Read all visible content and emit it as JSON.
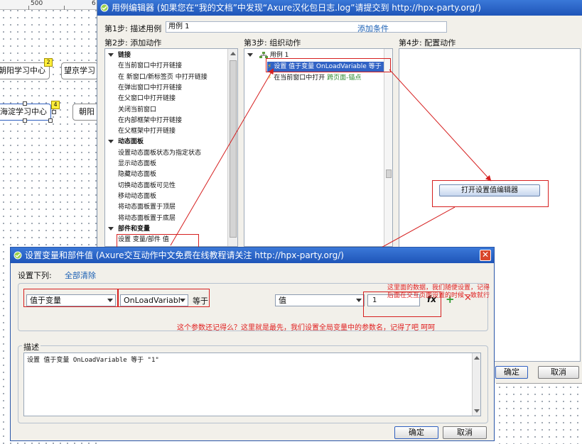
{
  "canvas": {
    "ruler_mark": "500",
    "ruler_mark_right": "6",
    "widgets": [
      {
        "label": "朝阳学习中心",
        "badge": "2"
      },
      {
        "label": "望京学习"
      },
      {
        "label": "海淀学习中心",
        "badge": "4"
      },
      {
        "label": "朝阳"
      }
    ]
  },
  "case_editor": {
    "title": "用例编辑器 (如果您在“我的文档”中发现“Axure汉化包日志.log”请提交到 http://hpx-party.org/)",
    "step1_label": "第1步: 描述用例",
    "case_name": "用例 1",
    "add_condition": "添加条件",
    "step2_label": "第2步: 添加动作",
    "step3_label": "第3步: 组织动作",
    "step4_label": "第4步: 配置动作",
    "actions": [
      {
        "text": "链接",
        "header": true
      },
      {
        "text": "在当前窗口中打开链接"
      },
      {
        "text": "在 新窗口/新标签页 中打开链接"
      },
      {
        "text": "在弹出窗口中打开链接"
      },
      {
        "text": "在父窗口中打开链接"
      },
      {
        "text": "关闭当前窗口"
      },
      {
        "text": "在内部框架中打开链接"
      },
      {
        "text": "在父框架中打开链接"
      },
      {
        "text": "动态面板",
        "header": true
      },
      {
        "text": "设置动态面板状态为指定状态"
      },
      {
        "text": "显示动态面板"
      },
      {
        "text": "隐藏动态面板"
      },
      {
        "text": "切换动态面板可见性"
      },
      {
        "text": "移动动态面板"
      },
      {
        "text": "将动态面板置于顶层"
      },
      {
        "text": "将动态面板置于底层"
      },
      {
        "text": "部件和变量",
        "header": true
      },
      {
        "text": "设置 变量/部件 值"
      }
    ],
    "organize": {
      "case": "用例 1",
      "action1": "设置 值于变量 OnLoadVariable 等于",
      "action2_prefix": "在当前窗口中打开",
      "action2_link": "跨页面-锚点"
    },
    "open_editor_button": "打开设置值编辑器",
    "ok": "确定",
    "cancel": "取消"
  },
  "set_dialog": {
    "title": "设置变量和部件值 (Axure交互动作中文免费在线教程请关注 http://hpx-party.org/)",
    "set_list_label": "设置下列:",
    "clear_all": "全部清除",
    "target_type": "值于变量",
    "variable": "OnLoadVariabl",
    "equals": "等于",
    "value_type": "值",
    "value": "1",
    "fx_label": "fx",
    "annotation_top": "这里面的数据，我们随便设置，记得后面在交互页面设置的时候一致就行",
    "annotation_bottom": "这个参数还记得么？这里就是最先，我们设置全局变量中的参数名，记得了吧 呵呵",
    "desc_label": "描述",
    "desc_text": "设置 值于变量 OnLoadVariable 等于 \"1\"",
    "ok": "确定",
    "cancel": "取消"
  },
  "colors": {
    "title_bar": "#2a63c8",
    "annotation_red": "#e02020",
    "link_blue": "#1a5fb4"
  }
}
